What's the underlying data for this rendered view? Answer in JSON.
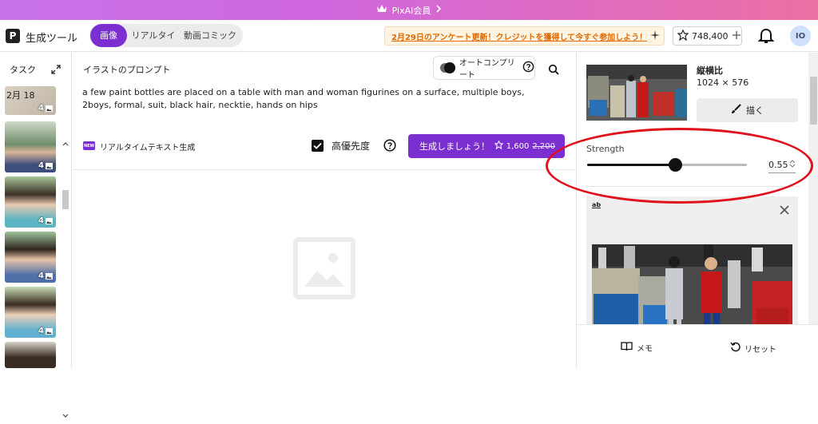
{
  "banner": {
    "text": "PixAI会員"
  },
  "header": {
    "logo": "P",
    "brand": "生成ツール",
    "modes": [
      {
        "label": "画像"
      },
      {
        "label": "リアルタイム"
      },
      {
        "label": "動画コミック"
      }
    ],
    "announcement": "2月29日のアンケート更新！クレジットを獲得して今すぐ参加しよう！",
    "credits": "748,400",
    "avatar": "IO"
  },
  "sidebar": {
    "title": "タスク",
    "date": "2月 18",
    "thumbs": [
      {
        "count": "4"
      },
      {
        "count": "4"
      },
      {
        "count": "4"
      },
      {
        "count": "4"
      },
      {
        "count": "4"
      }
    ]
  },
  "prompt": {
    "label": "イラストのプロンプト",
    "autocomplete_label": "オートコンプリート",
    "text": "a few paint bottles are placed on a table with man and woman figurines on a surface, multiple boys, 2boys, formal, suit, black hair, necktie, hands on hips",
    "new_badge": "NEW",
    "realtime_label": "リアルタイムテキスト生成",
    "priority_label": "高優先度",
    "generate_label": "生成しましょう！",
    "cost_new": "1,600",
    "cost_old": "2,200"
  },
  "right": {
    "aspect_label": "縦横比",
    "aspect_value": "1024 × 576",
    "draw_label": "描く",
    "strength_label": "Strength",
    "strength_value": "0.55",
    "strength_fraction": 0.55,
    "ab_label": "ab",
    "memo_label": "メモ",
    "reset_label": "リセット"
  },
  "colors": {
    "accent": "#7b2fd0",
    "annotation": "#e0101c",
    "announce": "#e06a00"
  }
}
